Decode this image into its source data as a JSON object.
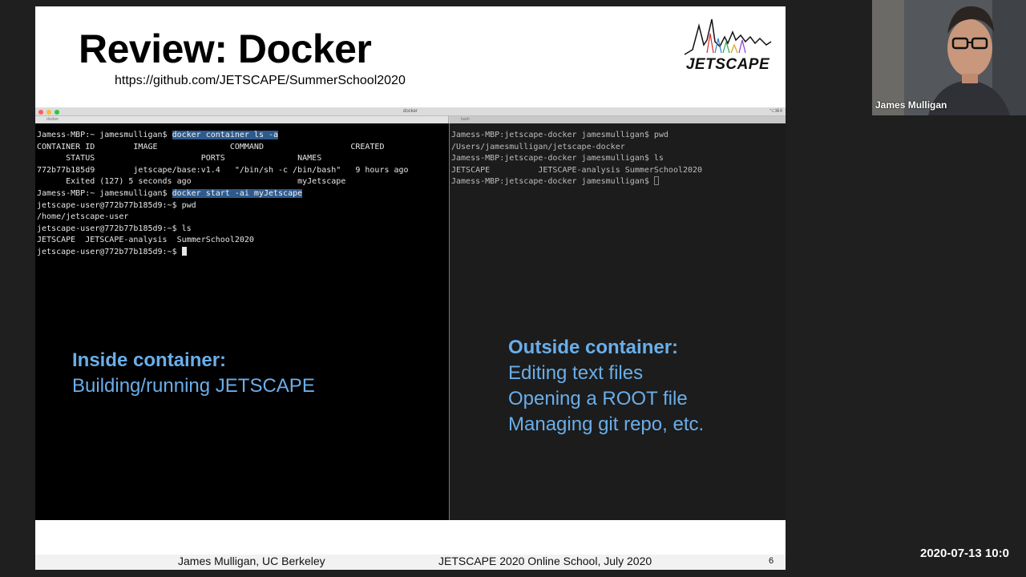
{
  "slide": {
    "title": "Review: Docker",
    "url": "https://github.com/JETSCAPE/SummerSchool2020",
    "logo_text": "JETSCAPE"
  },
  "terminal": {
    "window_title": "docker",
    "shortcut": "⌥⌘4",
    "tabs": [
      "docker",
      "bash"
    ],
    "left": {
      "lines": [
        {
          "prompt": "Jamess-MBP:~ jamesmulligan$ ",
          "cmd": "docker container ls -a"
        },
        {
          "text": "CONTAINER ID        IMAGE               COMMAND                  CREATED"
        },
        {
          "text": "      STATUS                      PORTS               NAMES"
        },
        {
          "text": "772b77b185d9        jetscape/base:v1.4   \"/bin/sh -c /bin/bash\"   9 hours ago"
        },
        {
          "text": "      Exited (127) 5 seconds ago                      myJetscape"
        },
        {
          "prompt": "Jamess-MBP:~ jamesmulligan$ ",
          "cmd": "docker start -ai myJetscape"
        },
        {
          "text": "jetscape-user@772b77b185d9:~$ pwd"
        },
        {
          "text": "/home/jetscape-user"
        },
        {
          "text": "jetscape-user@772b77b185d9:~$ ls"
        },
        {
          "text": "JETSCAPE  JETSCAPE-analysis  SummerSchool2020"
        },
        {
          "text": "jetscape-user@772b77b185d9:~$ "
        }
      ]
    },
    "right": {
      "lines": [
        {
          "text": "Jamess-MBP:jetscape-docker jamesmulligan$ pwd"
        },
        {
          "text": "/Users/jamesmulligan/jetscape-docker"
        },
        {
          "text": "Jamess-MBP:jetscape-docker jamesmulligan$ ls"
        },
        {
          "text": "JETSCAPE          JETSCAPE-analysis SummerSchool2020"
        },
        {
          "text": "Jamess-MBP:jetscape-docker jamesmulligan$ "
        }
      ]
    }
  },
  "callouts": {
    "inside": {
      "heading": "Inside container:",
      "lines": [
        "Building/running JETSCAPE"
      ]
    },
    "outside": {
      "heading": "Outside container:",
      "lines": [
        "Editing text files",
        "Opening a ROOT file",
        "Managing git repo, etc."
      ]
    }
  },
  "footer": {
    "author": "James Mulligan, UC Berkeley",
    "event": "JETSCAPE 2020 Online School, July 2020",
    "page": "6"
  },
  "video": {
    "participant_name": "James Mulligan",
    "timestamp": "2020-07-13 10:0"
  },
  "colors": {
    "callout": "#6aaeea",
    "selection": "#2f5a8c",
    "dir_blue": "#2a3c8a"
  }
}
